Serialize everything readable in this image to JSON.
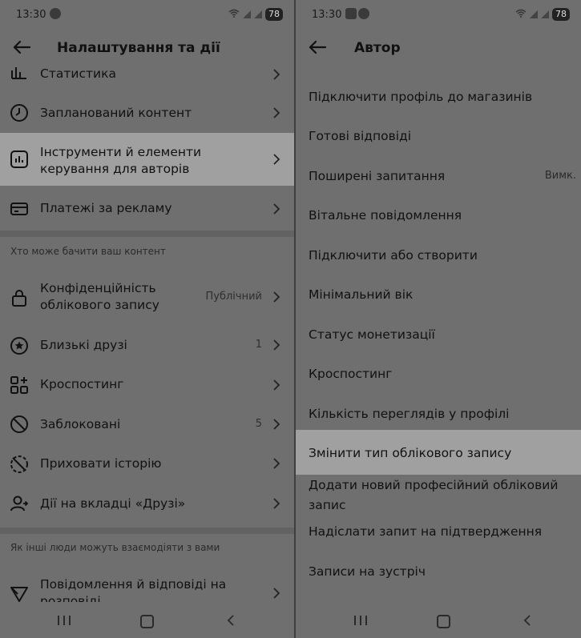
{
  "left": {
    "status": {
      "time": "13:30",
      "battery": "78"
    },
    "title": "Налаштування та дії",
    "rows_top": [
      {
        "label": "Статистика",
        "icon": "stats-icon"
      },
      {
        "label": "Запланований контент",
        "icon": "clock-icon"
      },
      {
        "label": "Інструменти й елементи керування для авторів",
        "icon": "chart-box-icon"
      },
      {
        "label": "Платежі за рекламу",
        "icon": "card-icon"
      }
    ],
    "section1": "Хто може бачити ваш контент",
    "rows_mid": [
      {
        "label": "Конфіденційність облікового запису",
        "value": "Публічний",
        "icon": "lock-icon"
      },
      {
        "label": "Близькі друзі",
        "value": "1",
        "icon": "star-circle-icon"
      },
      {
        "label": "Кроспостинг",
        "value": "",
        "icon": "grid-plus-icon"
      },
      {
        "label": "Заблоковані",
        "value": "5",
        "icon": "block-icon"
      },
      {
        "label": "Приховати історію",
        "value": "",
        "icon": "hide-story-icon"
      },
      {
        "label": "Дії на вкладці «Друзі»",
        "value": "",
        "icon": "friends-icon"
      }
    ],
    "section2": "Як інші люди можуть взаємодіяти з вами",
    "rows_bottom": [
      {
        "label": "Повідомлення й відповіді на розповіді",
        "icon": "send-icon"
      }
    ]
  },
  "right": {
    "status": {
      "time": "13:30",
      "battery": "78"
    },
    "title": "Автор",
    "items": [
      {
        "label": "Підключити профіль до магазинів"
      },
      {
        "label": "Готові відповіді"
      },
      {
        "label": "Поширені запитання",
        "value": "Вимк."
      },
      {
        "label": "Вітальне повідомлення"
      },
      {
        "label": "Підключити або створити"
      },
      {
        "label": "Мінімальний вік"
      },
      {
        "label": "Статус монетизації"
      },
      {
        "label": "Кроспостинг"
      },
      {
        "label": "Кількість переглядів у профілі"
      },
      {
        "label": "Змінити тип облікового запису"
      },
      {
        "label": "Додати новий професійний обліковий запис"
      },
      {
        "label": "Надіслати запит на підтвердження"
      },
      {
        "label": "Записи на зустріч"
      }
    ]
  }
}
